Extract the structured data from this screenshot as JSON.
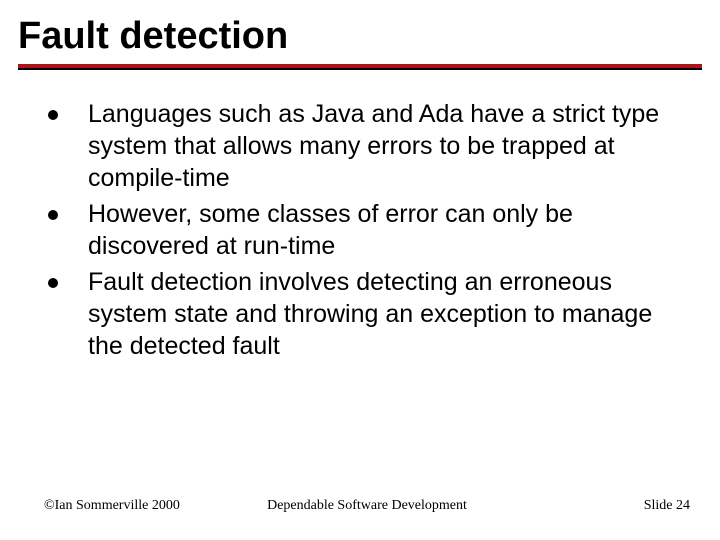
{
  "title": "Fault detection",
  "bullets": [
    "Languages such as Java and Ada have a strict type system that allows many errors to be trapped at compile-time",
    "However, some classes of error can only be discovered at run-time",
    "Fault detection involves detecting an erroneous system state and throwing an exception to manage the detected fault"
  ],
  "footer": {
    "left": "©Ian Sommerville 2000",
    "center": "Dependable Software Development",
    "right": "Slide 24"
  },
  "colors": {
    "rule": "#b0121b"
  }
}
